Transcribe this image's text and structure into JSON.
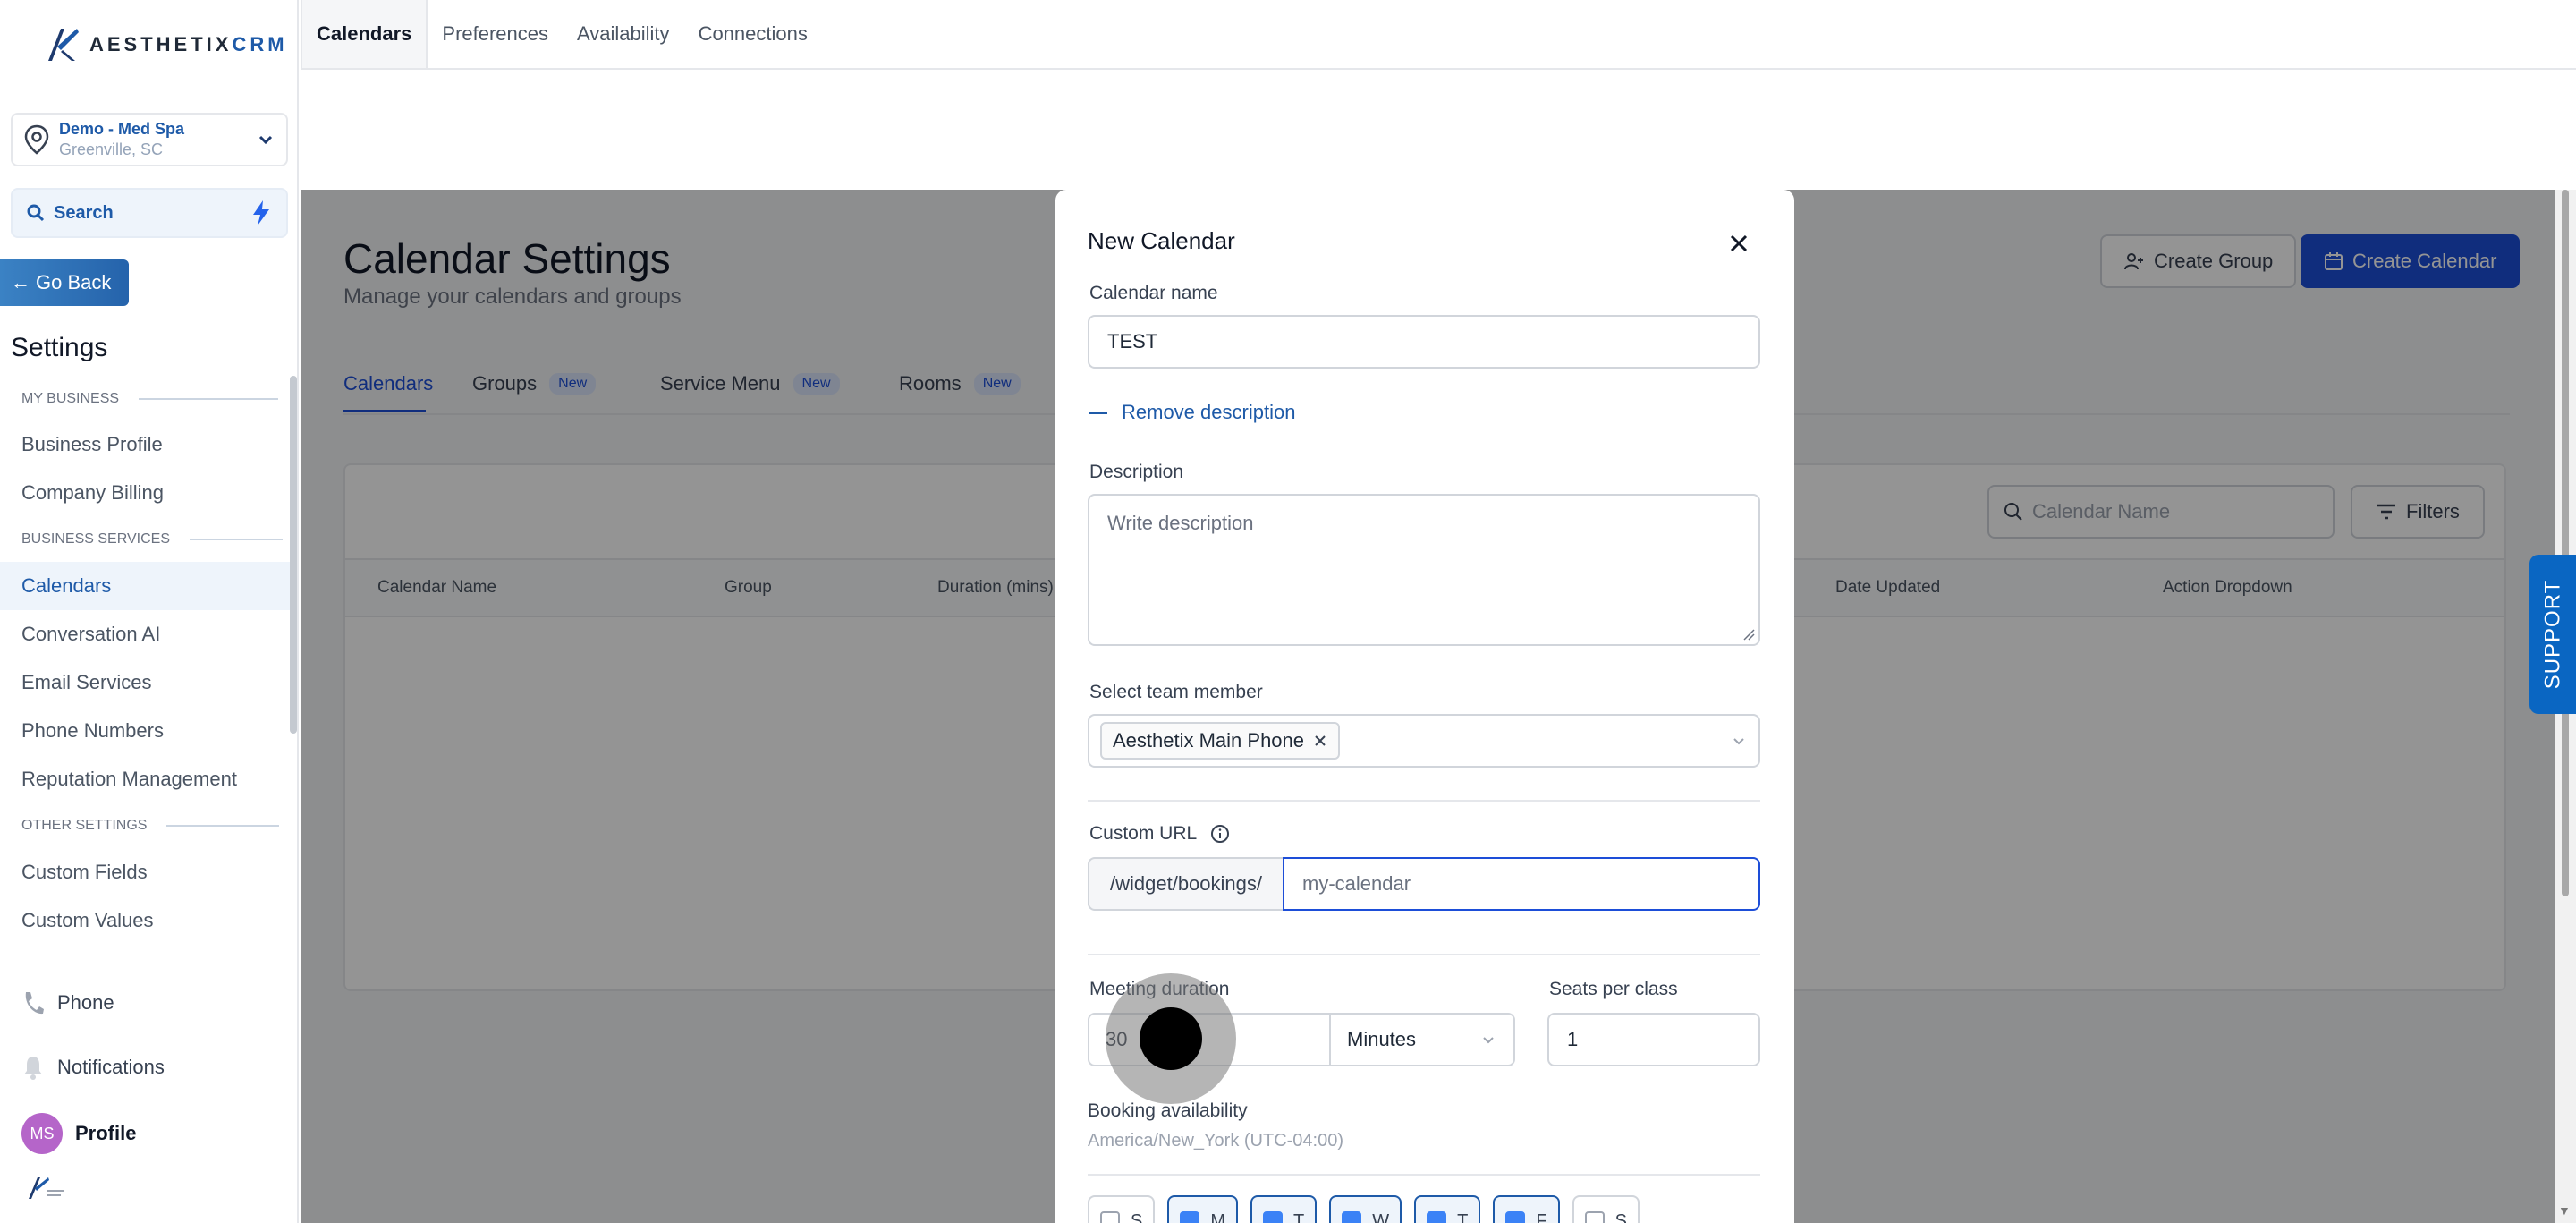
{
  "sidebar": {
    "logo_main": "AESTHETIX",
    "logo_accent": "CRM",
    "location_name": "Demo - Med Spa",
    "location_sub": "Greenville, SC",
    "search_label": "Search",
    "go_back": "Go Back",
    "settings_title": "Settings",
    "sections": {
      "my_business": "MY BUSINESS",
      "business_services": "BUSINESS SERVICES",
      "other_settings": "OTHER SETTINGS"
    },
    "items": {
      "business_profile": "Business Profile",
      "company_billing": "Company Billing",
      "calendars": "Calendars",
      "conversation_ai": "Conversation AI",
      "email_services": "Email Services",
      "phone_numbers": "Phone Numbers",
      "reputation_management": "Reputation Management",
      "custom_fields": "Custom Fields",
      "custom_values": "Custom Values"
    },
    "bottom": {
      "phone": "Phone",
      "notifications": "Notifications",
      "profile": "Profile",
      "avatar_initials": "MS"
    }
  },
  "top_tabs": [
    "Calendars",
    "Preferences",
    "Availability",
    "Connections"
  ],
  "main": {
    "title": "Calendar Settings",
    "subtitle": "Manage your calendars and groups",
    "create_group": "Create Group",
    "create_calendar": "Create Calendar",
    "tabs": {
      "calendars": "Calendars",
      "groups": "Groups",
      "service_menu": "Service Menu",
      "rooms": "Rooms",
      "new_badge": "New"
    },
    "table": {
      "search_placeholder": "Calendar Name",
      "filters": "Filters",
      "headers": {
        "calendar_name": "Calendar Name",
        "group": "Group",
        "duration": "Duration (mins)",
        "date_updated": "Date Updated",
        "action": "Action Dropdown"
      }
    }
  },
  "support": "SUPPORT",
  "modal": {
    "title": "New Calendar",
    "calendar_name_label": "Calendar name",
    "calendar_name_value": "TEST",
    "remove_description": "Remove description",
    "description_label": "Description",
    "description_placeholder": "Write description",
    "team_member_label": "Select team member",
    "team_member_chip": "Aesthetix Main Phone",
    "custom_url_label": "Custom URL",
    "url_prefix": "/widget/bookings/",
    "url_placeholder": "my-calendar",
    "meeting_duration_label": "Meeting duration",
    "duration_value": "30",
    "duration_unit": "Minutes",
    "seats_label": "Seats per class",
    "seats_value": "1",
    "booking_availability_label": "Booking availability",
    "timezone": "America/New_York (UTC-04:00)",
    "days": {
      "sun": "S",
      "mon": "M",
      "tue": "T",
      "wed": "W",
      "thu": "T",
      "fri": "F",
      "sat": "S"
    }
  },
  "colors": {
    "brand_blue": "#1e5aa8",
    "primary_button": "#1d4ed8",
    "support_tab": "#0a66c2",
    "avatar": "#b565c9"
  }
}
